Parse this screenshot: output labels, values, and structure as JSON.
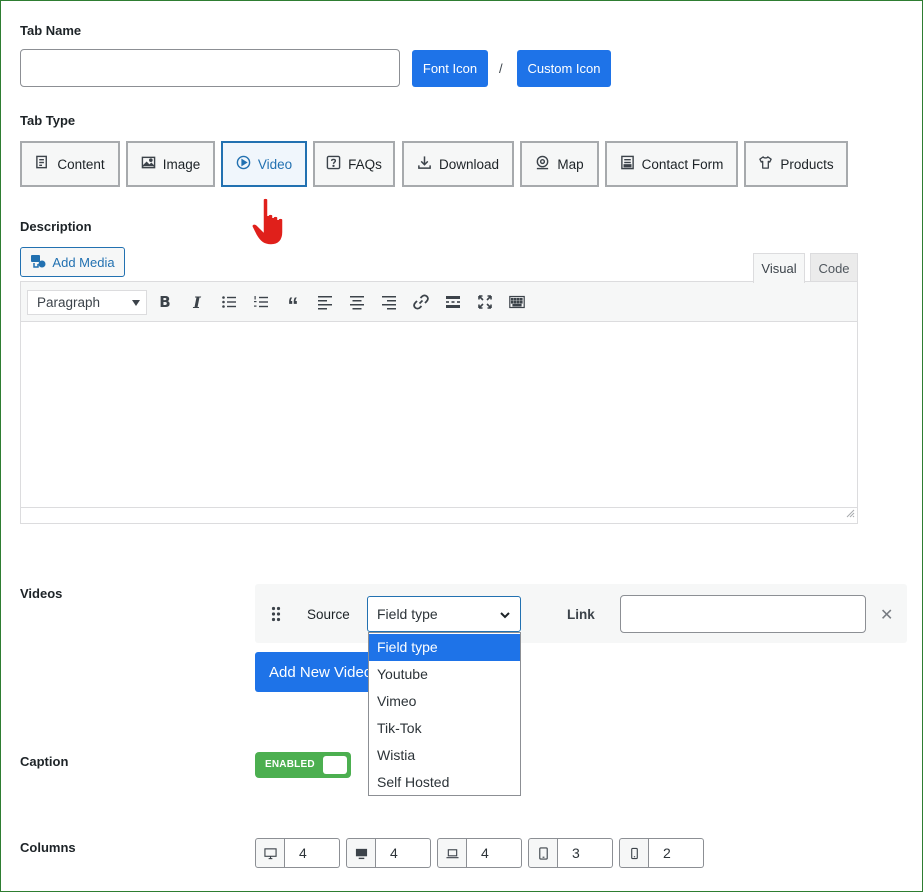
{
  "tab_name": {
    "label": "Tab Name",
    "value": "",
    "font_icon_label": "Font Icon",
    "separator": "/",
    "custom_icon_label": "Custom Icon"
  },
  "tab_type": {
    "label": "Tab Type",
    "options": [
      {
        "label": "Content",
        "icon": "content-icon"
      },
      {
        "label": "Image",
        "icon": "image-icon"
      },
      {
        "label": "Video",
        "icon": "play-circle-icon",
        "active": true
      },
      {
        "label": "FAQs",
        "icon": "question-icon"
      },
      {
        "label": "Download",
        "icon": "download-icon"
      },
      {
        "label": "Map",
        "icon": "map-pin-icon"
      },
      {
        "label": "Contact Form",
        "icon": "form-icon"
      },
      {
        "label": "Products",
        "icon": "tshirt-icon"
      }
    ]
  },
  "description": {
    "label": "Description",
    "add_media_label": "Add Media",
    "tabs": {
      "visual": "Visual",
      "code": "Code"
    },
    "format_select": "Paragraph",
    "content": ""
  },
  "videos": {
    "label": "Videos",
    "source_label": "Source",
    "source_value": "Field type",
    "link_label": "Link",
    "link_value": "",
    "add_new_label": "Add New Video",
    "dropdown_options": [
      "Field type",
      "Youtube",
      "Vimeo",
      "Tik-Tok",
      "Wistia",
      "Self Hosted"
    ],
    "selected_option": "Field type"
  },
  "caption": {
    "label": "Caption",
    "toggle_label": "ENABLED",
    "enabled": true
  },
  "columns": {
    "label": "Columns",
    "values": [
      {
        "device": "desktop-icon",
        "value": "4"
      },
      {
        "device": "monitor-icon",
        "value": "4"
      },
      {
        "device": "laptop-icon",
        "value": "4"
      },
      {
        "device": "tablet-icon",
        "value": "3"
      },
      {
        "device": "mobile-icon",
        "value": "2"
      }
    ]
  },
  "colors": {
    "primary_blue": "#1e73e8",
    "toggle_green": "#4caf50",
    "frame_green": "#2e7d32",
    "pointer_red": "#e0201b"
  }
}
